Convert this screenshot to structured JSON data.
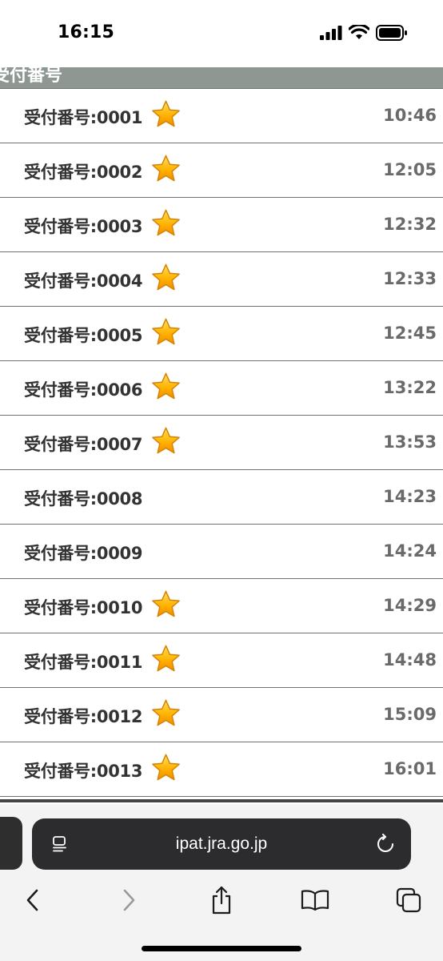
{
  "status_bar": {
    "time": "16:15"
  },
  "section_header": {
    "title": "受付番号"
  },
  "receipts": [
    {
      "label": "受付番号:0001",
      "time": "10:46",
      "starred": true
    },
    {
      "label": "受付番号:0002",
      "time": "12:05",
      "starred": true
    },
    {
      "label": "受付番号:0003",
      "time": "12:32",
      "starred": true
    },
    {
      "label": "受付番号:0004",
      "time": "12:33",
      "starred": true
    },
    {
      "label": "受付番号:0005",
      "time": "12:45",
      "starred": true
    },
    {
      "label": "受付番号:0006",
      "time": "13:22",
      "starred": true
    },
    {
      "label": "受付番号:0007",
      "time": "13:53",
      "starred": true
    },
    {
      "label": "受付番号:0008",
      "time": "14:23",
      "starred": false
    },
    {
      "label": "受付番号:0009",
      "time": "14:24",
      "starred": false
    },
    {
      "label": "受付番号:0010",
      "time": "14:29",
      "starred": true
    },
    {
      "label": "受付番号:0011",
      "time": "14:48",
      "starred": true
    },
    {
      "label": "受付番号:0012",
      "time": "15:09",
      "starred": true
    },
    {
      "label": "受付番号:0013",
      "time": "16:01",
      "starred": true
    }
  ],
  "browser": {
    "url": "ipat.jra.go.jp",
    "toolbar_icons": [
      "back-icon",
      "forward-icon",
      "share-icon",
      "bookmarks-icon",
      "tabs-icon"
    ]
  },
  "colors": {
    "header_bg": "#8e9792",
    "star": "#f5a800",
    "time_text": "#6a6a6a",
    "label_text": "#333333"
  }
}
